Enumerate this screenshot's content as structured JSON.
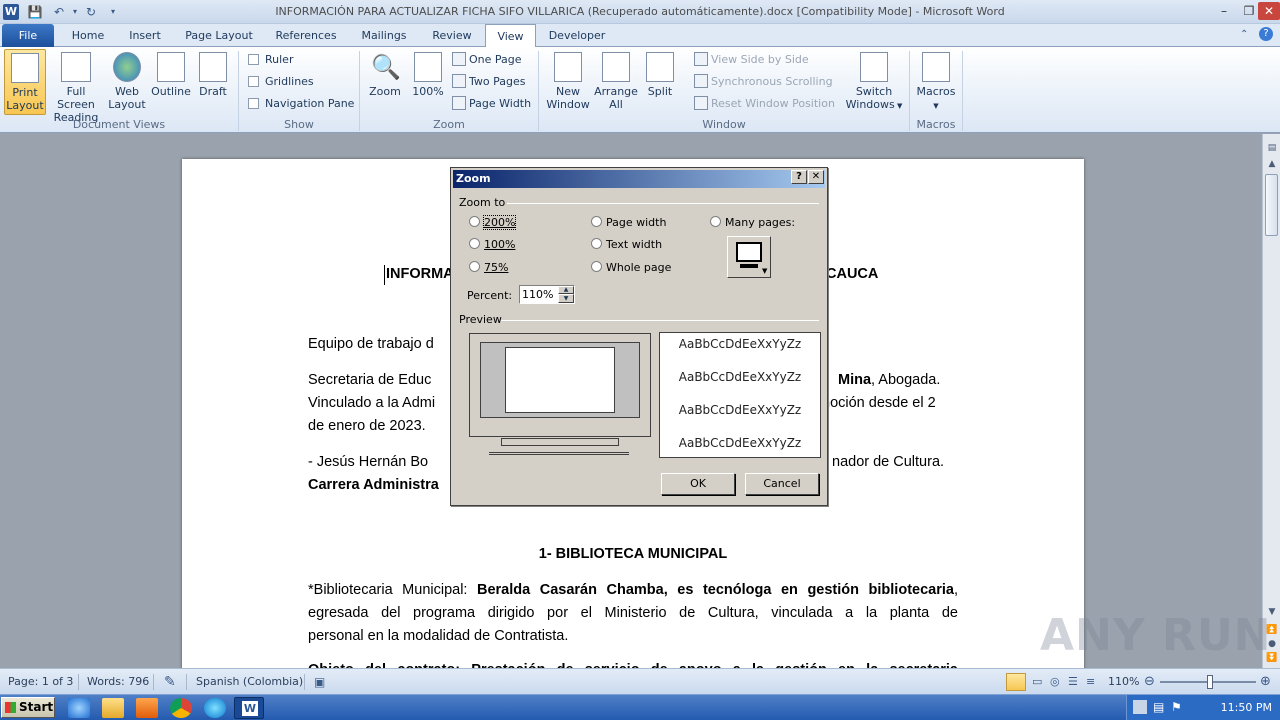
{
  "window": {
    "title": "INFORMACIÓN PARA ACTUALIZAR FICHA SIFO VILLARICA (Recuperado automáticamente).docx [Compatibility Mode]  -  Microsoft Word",
    "app_icon": "W"
  },
  "tabs": [
    "File",
    "Home",
    "Insert",
    "Page Layout",
    "References",
    "Mailings",
    "Review",
    "View",
    "Developer"
  ],
  "active_tab": "View",
  "ribbon": {
    "document_views": {
      "label": "Document Views",
      "print_layout": "Print Layout",
      "print_layout_l1": "Print",
      "print_layout_l2": "Layout",
      "full_screen_l1": "Full Screen",
      "full_screen_l2": "Reading",
      "web_l1": "Web",
      "web_l2": "Layout",
      "outline": "Outline",
      "draft": "Draft"
    },
    "show": {
      "label": "Show",
      "ruler": "Ruler",
      "gridlines": "Gridlines",
      "navigation_pane": "Navigation Pane"
    },
    "zoom": {
      "label": "Zoom",
      "zoom": "Zoom",
      "hundred": "100%",
      "one_page": "One Page",
      "two_pages": "Two Pages",
      "page_width": "Page Width"
    },
    "window": {
      "label": "Window",
      "new_l1": "New",
      "new_l2": "Window",
      "arrange_l1": "Arrange",
      "arrange_l2": "All",
      "split": "Split",
      "side_by_side": "View Side by Side",
      "sync_scroll": "Synchronous Scrolling",
      "reset_pos": "Reset Window Position",
      "switch_l1": "Switch",
      "switch_l2": "Windows"
    },
    "macros": {
      "label": "Macros",
      "macros": "Macros"
    }
  },
  "document": {
    "heading_left": "INFORMA",
    "heading_right": "CAUCA",
    "p1": "Equipo de trabajo d",
    "p2_l1_left": "Secretaria de Educ",
    "p2_l1_bold": "Mina",
    "p2_l1_right": ", Abogada.",
    "p2_l2_left": "Vinculado a la Admi",
    "p2_l2_right": "moción desde el 2",
    "p2_l3": "de enero de 2023.",
    "p3_l1_left": "- Jesús Hernán Bo",
    "p3_l1_right": "nador de Cultura.",
    "p3_l2_bold": "Carrera Administra",
    "section_title": "1- BIBLIOTECA MUNICIPAL",
    "p4_l1_a": "*Bibliotecaria Municipal",
    "p4_l1_b": ": ",
    "p4_l1_bold": "Beralda Casarán Chamba, es tecnóloga en gestión bibliotecaria",
    "p4_l1_c": ",",
    "p4_l2": "egresada del programa dirigido por el Ministerio de Cultura, vinculada a la planta de",
    "p4_l3": "personal en la modalidad de Contratista.",
    "p5_partial": "Objeto del contrato: Prestación de servicio de apoyo a la gestión en la secretaria"
  },
  "zoom_dialog": {
    "title": "Zoom",
    "help": "?",
    "close": "✕",
    "zoom_to": "Zoom to",
    "r200": "200%",
    "r100": "100%",
    "r75": "75%",
    "page_width": "Page width",
    "text_width": "Text width",
    "whole_page": "Whole page",
    "many_pages": "Many pages:",
    "percent_label": "Percent:",
    "percent_value": "110%",
    "preview": "Preview",
    "sample": [
      "AaBbCcDdEeXxYyZz",
      "AaBbCcDdEeXxYyZz",
      "AaBbCcDdEeXxYyZz",
      "AaBbCcDdEeXxYyZz"
    ],
    "ok": "OK",
    "cancel": "Cancel"
  },
  "status": {
    "page": "Page: 1 of 3",
    "words": "Words: 796",
    "language": "Spanish (Colombia)",
    "zoom": "110%"
  },
  "taskbar": {
    "start": "Start",
    "clock": "11:50 PM"
  },
  "watermark": "ANY RUN"
}
